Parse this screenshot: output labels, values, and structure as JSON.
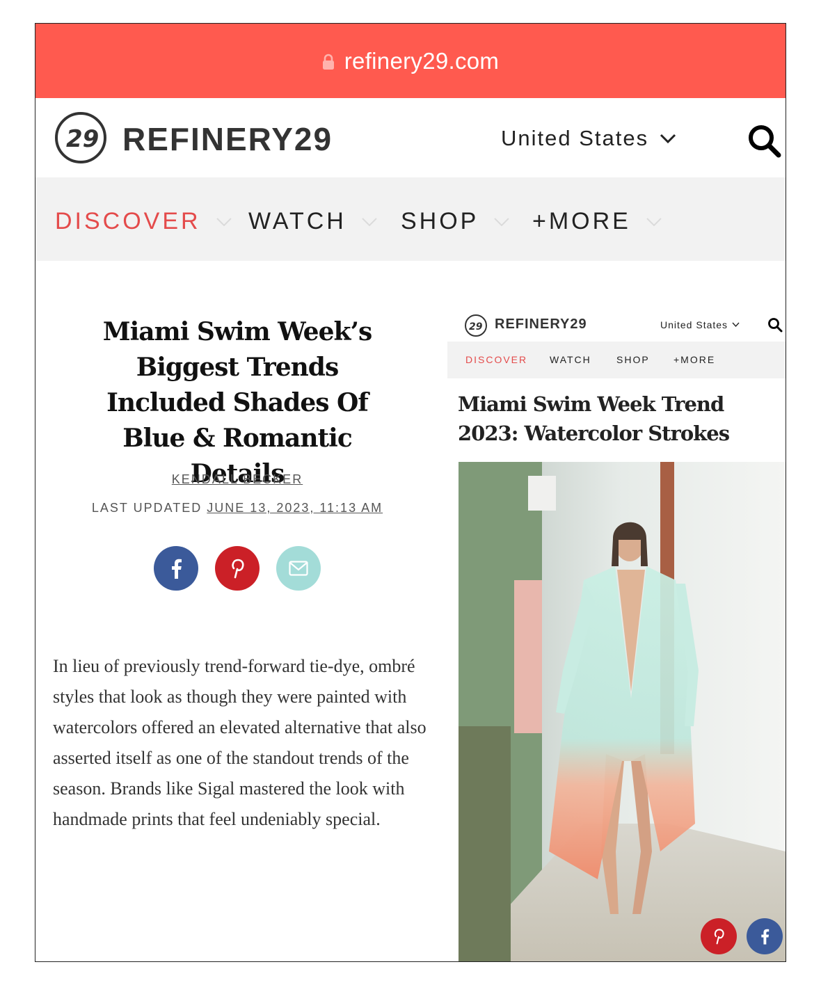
{
  "browser": {
    "url": "refinery29.com"
  },
  "header": {
    "brand": "REFINERY29",
    "country": "United States"
  },
  "nav": {
    "items": [
      "DISCOVER",
      "WATCH",
      "SHOP",
      "+MORE"
    ]
  },
  "article": {
    "headline": "Miami Swim Week’s Biggest Trends Included Shades Of Blue & Romantic Details",
    "author": "KENDALL BECKER",
    "updated_label": "LAST UPDATED",
    "updated_date": "JUNE 13, 2023, 11:13 AM",
    "body": "In lieu of previously trend-forward tie-dye, ombré styles that look as though they were painted with watercolors offered an elevated alternative that also asserted itself as one of the standout trends of the season. Brands like Sigal mastered the look with handmade prints that feel undeniably special."
  },
  "inset": {
    "brand": "REFINERY29",
    "country": "United States",
    "nav": [
      "DISCOVER",
      "WATCH",
      "SHOP",
      "+MORE"
    ],
    "title": "Miami Swim Week Trend 2023: Watercolor Strokes"
  },
  "colors": {
    "url_bar": "#ff5a4f",
    "accent": "#e44b4b",
    "facebook": "#3b5a9a",
    "pinterest": "#cb2027",
    "email": "#a3dcd8"
  }
}
